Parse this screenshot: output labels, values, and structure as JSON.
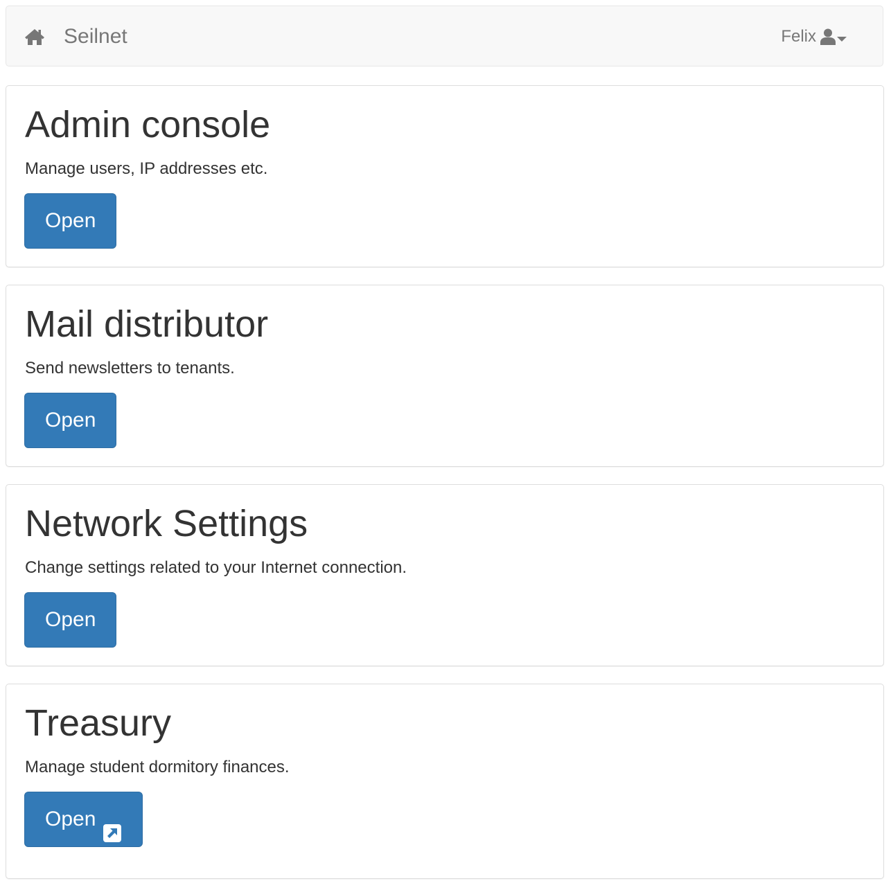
{
  "navbar": {
    "brand": "Seilnet",
    "brand_icon": "home-icon",
    "user_name": "Felix",
    "user_icon": "user-icon",
    "dropdown_icon": "caret-down-icon",
    "bg_color": "#f8f8f8",
    "text_color": "#777777"
  },
  "panels": [
    {
      "title": "Admin console",
      "description": "Manage users, IP addresses etc.",
      "button_label": "Open",
      "external": false
    },
    {
      "title": "Mail distributor",
      "description": "Send newsletters to tenants.",
      "button_label": "Open",
      "external": false
    },
    {
      "title": "Network Settings",
      "description": "Change settings related to your Internet connection.",
      "button_label": "Open",
      "external": false
    },
    {
      "title": "Treasury",
      "description": "Manage student dormitory finances.",
      "button_label": "Open",
      "external": true,
      "button_icon": "external-link-icon"
    }
  ],
  "colors": {
    "primary_button": "#337ab7",
    "panel_border": "#dddddd",
    "text": "#333333"
  }
}
